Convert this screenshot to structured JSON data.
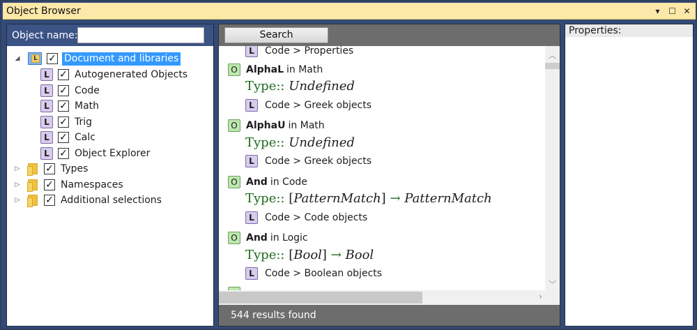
{
  "window": {
    "title": "Object Browser",
    "controls": {
      "pin": "▾",
      "maximize": "☐",
      "close": "✕"
    }
  },
  "left": {
    "object_name_label": "Object name:",
    "object_name_value": "",
    "tree": [
      {
        "label": "Document and libraries",
        "checked": true,
        "expanded": true,
        "selected": true
      },
      {
        "label": "Autogenerated Objects",
        "checked": true
      },
      {
        "label": "Code",
        "checked": true
      },
      {
        "label": "Math",
        "checked": true
      },
      {
        "label": "Trig",
        "checked": true
      },
      {
        "label": "Calc",
        "checked": true
      },
      {
        "label": "Object Explorer",
        "checked": true
      },
      {
        "label": "Types",
        "checked": true,
        "expanded": false
      },
      {
        "label": "Namespaces",
        "checked": true,
        "expanded": false
      },
      {
        "label": "Additional selections",
        "checked": true,
        "expanded": false
      }
    ],
    "lib_badge": "L"
  },
  "middle": {
    "search_label": "Search",
    "obj_badge": "O",
    "lib_badge": "L",
    "top_partial_path": "Code > Properties",
    "results": [
      {
        "name": "AlphaL",
        "in": "in Math",
        "type_prefix": "Type::",
        "type_parts": [
          "Undefined"
        ],
        "path": "Code > Greek objects"
      },
      {
        "name": "AlphaU",
        "in": "in Math",
        "type_prefix": "Type::",
        "type_parts": [
          "Undefined"
        ],
        "path": "Code > Greek objects"
      },
      {
        "name": "And",
        "in": "in Code",
        "type_prefix": "Type::",
        "type_bracket_open": "[",
        "type_arg": "PatternMatch",
        "type_bracket_close": "]",
        "type_arrow": "→",
        "type_result": "PatternMatch",
        "path": "Code > Code objects"
      },
      {
        "name": "And",
        "in": "in Logic",
        "type_prefix": "Type::",
        "type_bracket_open": "[",
        "type_arg": "Bool",
        "type_bracket_close": "]",
        "type_arrow": "→",
        "type_result": "Bool",
        "path": "Code > Boolean objects"
      }
    ],
    "status": "544 results found",
    "scroll": {
      "up": "︿",
      "down": "﹀",
      "right": "›"
    }
  },
  "right": {
    "properties_label": "Properties:"
  },
  "colors": {
    "titlebar": "#fce8a9",
    "frame": "#344a76",
    "selection": "#3399ff",
    "type_green": "#1d6b1d"
  }
}
